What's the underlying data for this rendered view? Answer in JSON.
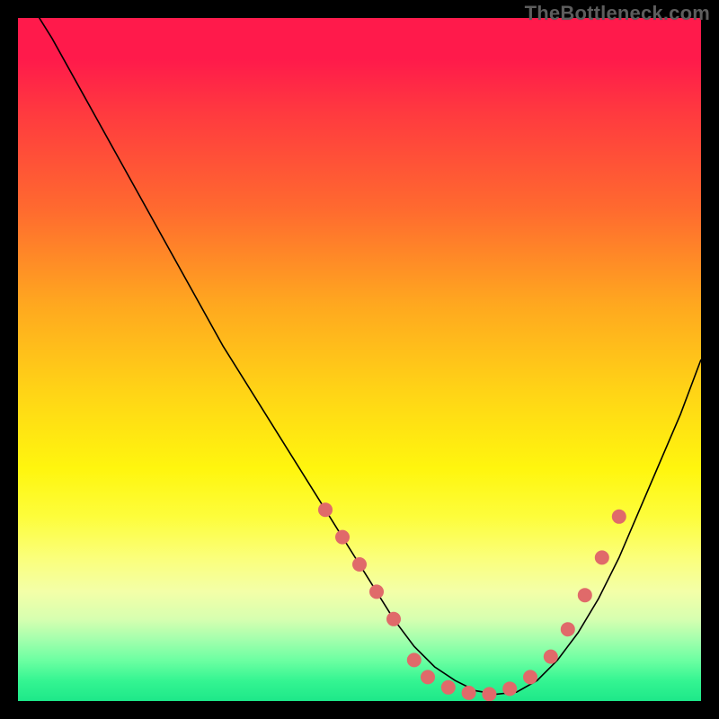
{
  "watermark": "TheBottleneck.com",
  "chart_data": {
    "type": "line",
    "title": "",
    "xlabel": "",
    "ylabel": "",
    "xlim": [
      0,
      100
    ],
    "ylim": [
      0,
      100
    ],
    "grid": false,
    "legend": false,
    "series": [
      {
        "name": "curve",
        "x": [
          0,
          5,
          10,
          15,
          20,
          25,
          30,
          35,
          40,
          45,
          50,
          55,
          58,
          61,
          64,
          67,
          70,
          73,
          76,
          79,
          82,
          85,
          88,
          91,
          94,
          97,
          100
        ],
        "y": [
          105,
          97,
          88,
          79,
          70,
          61,
          52,
          44,
          36,
          28,
          20,
          12,
          8,
          5,
          3,
          1.5,
          1,
          1.3,
          3,
          6,
          10,
          15,
          21,
          28,
          35,
          42,
          50
        ],
        "stroke": "#000000",
        "stroke_width": 1.6
      }
    ],
    "markers": {
      "name": "highlight-dots",
      "color": "#e06a6a",
      "radius": 8,
      "points": [
        {
          "x": 45,
          "y": 28
        },
        {
          "x": 47.5,
          "y": 24
        },
        {
          "x": 50,
          "y": 20
        },
        {
          "x": 52.5,
          "y": 16
        },
        {
          "x": 55,
          "y": 12
        },
        {
          "x": 58,
          "y": 6
        },
        {
          "x": 60,
          "y": 3.5
        },
        {
          "x": 63,
          "y": 2
        },
        {
          "x": 66,
          "y": 1.2
        },
        {
          "x": 69,
          "y": 1
        },
        {
          "x": 72,
          "y": 1.8
        },
        {
          "x": 75,
          "y": 3.5
        },
        {
          "x": 78,
          "y": 6.5
        },
        {
          "x": 80.5,
          "y": 10.5
        },
        {
          "x": 83,
          "y": 15.5
        },
        {
          "x": 85.5,
          "y": 21
        },
        {
          "x": 88,
          "y": 27
        }
      ]
    },
    "background_gradient": {
      "top": "#ff1a4b",
      "mid": "#fff60e",
      "bottom": "#1de889"
    }
  }
}
